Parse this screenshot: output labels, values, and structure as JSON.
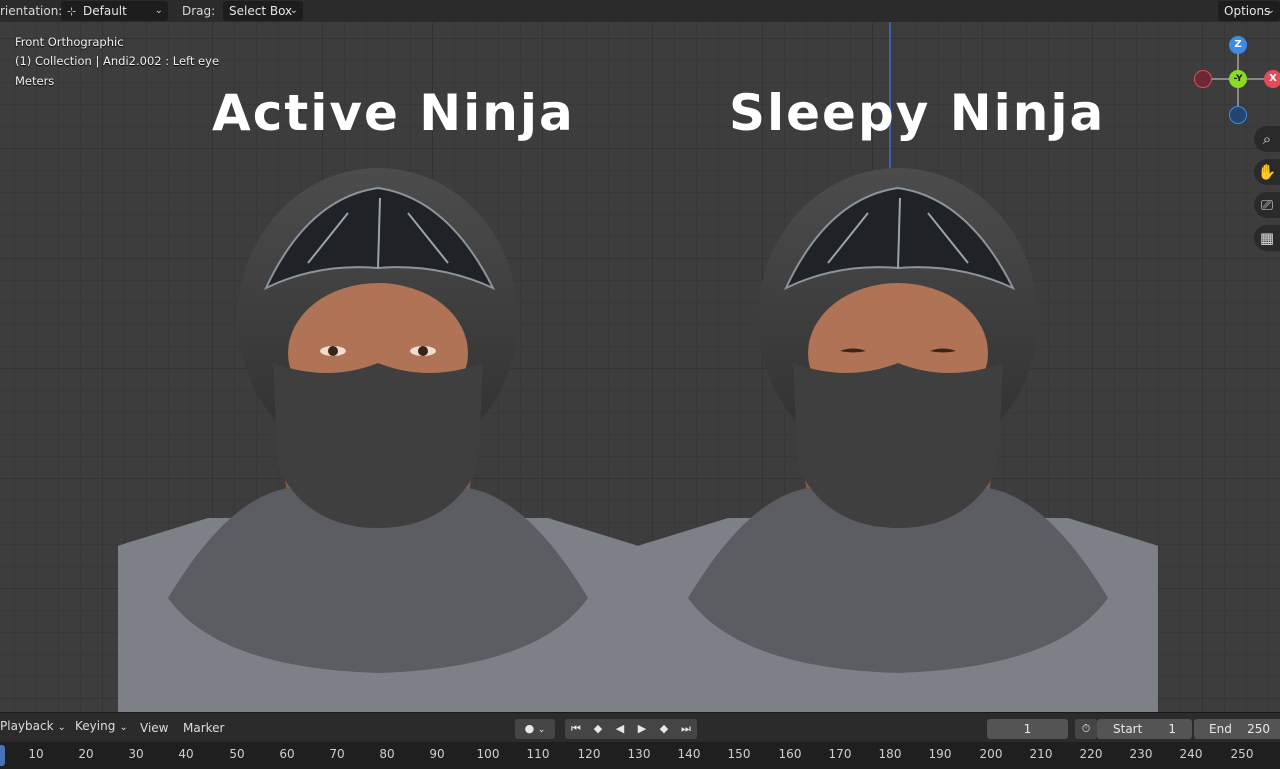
{
  "header": {
    "orientation_label": "rientation:",
    "orientation_value": "Default",
    "drag_label": "Drag:",
    "drag_value": "Select Box",
    "options_label": "Options"
  },
  "viewport": {
    "view_name": "Front Orthographic",
    "collection_info": "(1) Collection | Andi2.002 : Left eye",
    "units": "Meters",
    "left_title": "Active Ninja",
    "right_title": "Sleepy Ninja",
    "gizmo": {
      "z": "Z",
      "y": "-Y",
      "x": "X"
    },
    "nav_icons": [
      "zoom-icon",
      "hand-pan-icon",
      "camera-icon",
      "grid-icon"
    ]
  },
  "timeline": {
    "playback_label": "Playback",
    "keying_label": "Keying",
    "view_label": "View",
    "marker_label": "Marker",
    "current_frame": "1",
    "start_label": "Start",
    "start_value": "1",
    "end_label": "End",
    "end_value": "250",
    "ticks": [
      "10",
      "20",
      "30",
      "40",
      "50",
      "60",
      "70",
      "80",
      "90",
      "100",
      "110",
      "120",
      "130",
      "140",
      "150",
      "160",
      "170",
      "180",
      "190",
      "200",
      "210",
      "220",
      "230",
      "240",
      "250"
    ]
  },
  "colors": {
    "accent_blue": "#4772b3",
    "axis_x": "#e8495a",
    "axis_y": "#8bdc21",
    "axis_z": "#3e8ae6"
  }
}
